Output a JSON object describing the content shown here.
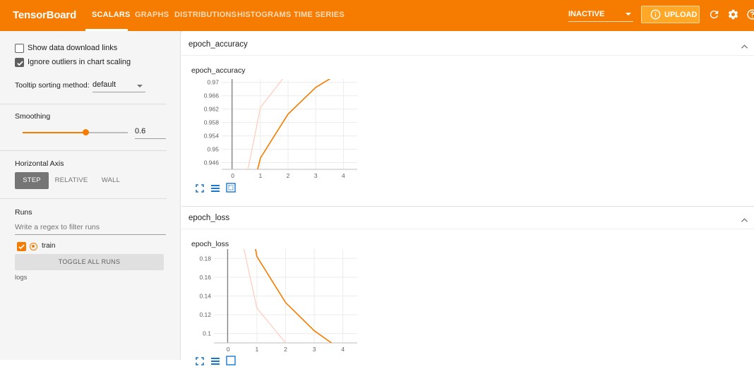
{
  "app": {
    "title": "TensorBoard",
    "accent": "#f57c00"
  },
  "tabs": [
    {
      "label": "SCALARS",
      "active": true
    },
    {
      "label": "GRAPHS"
    },
    {
      "label": "DISTRIBUTIONS"
    },
    {
      "label": "HISTOGRAMS"
    },
    {
      "label": "TIME SERIES"
    }
  ],
  "header": {
    "status_value": "INACTIVE",
    "upload_label": "UPLOAD",
    "icons": [
      "info-icon",
      "refresh-icon",
      "gear-icon",
      "help-icon"
    ]
  },
  "sidebar": {
    "show_download_links": {
      "label": "Show data download links",
      "checked": false
    },
    "ignore_outliers": {
      "label": "Ignore outliers in chart scaling",
      "checked": true
    },
    "tooltip_sort": {
      "label": "Tooltip sorting method:",
      "value": "default"
    },
    "smoothing": {
      "label": "Smoothing",
      "value": "0.6",
      "fraction": 0.6
    },
    "horizontal_axis": {
      "label": "Horizontal Axis",
      "options": [
        "STEP",
        "RELATIVE",
        "WALL"
      ],
      "selected": "STEP"
    },
    "runs": {
      "label": "Runs",
      "filter_placeholder": "Write a regex to filter runs",
      "items": [
        {
          "name": "train",
          "checked": true,
          "color": "#f57c00"
        }
      ],
      "toggle_all_label": "TOGGLE ALL RUNS",
      "logdir": "logs"
    }
  },
  "cards": [
    {
      "header": "epoch_accuracy",
      "chart_title": "epoch_accuracy"
    },
    {
      "header": "epoch_loss",
      "chart_title": "epoch_loss"
    }
  ],
  "chart_data": [
    {
      "type": "line",
      "title": "epoch_accuracy",
      "x_ticks": [
        0,
        1,
        2,
        3,
        4
      ],
      "y_ticks": [
        "0.946",
        "0.95",
        "0.954",
        "0.958",
        "0.962",
        "0.966",
        "0.97"
      ],
      "xlim": [
        -0.4,
        4.5
      ],
      "ylim": [
        0.944,
        0.971
      ],
      "series": [
        {
          "name": "train",
          "smoothed": true,
          "color": "#f57c00",
          "x": [
            0.9,
            1,
            2,
            3,
            3.6
          ],
          "y": [
            0.944,
            0.9474,
            0.9605,
            0.9685,
            0.9715
          ]
        },
        {
          "name": "train",
          "smoothed": false,
          "color": "#ffccbc",
          "x": [
            0.55,
            1,
            1.85
          ],
          "y": [
            0.944,
            0.9625,
            0.9715
          ]
        }
      ]
    },
    {
      "type": "line",
      "title": "epoch_loss",
      "x_ticks": [
        0,
        1,
        2,
        3,
        4
      ],
      "y_ticks": [
        "0.1",
        "0.12",
        "0.14",
        "0.16",
        "0.18"
      ],
      "xlim": [
        -0.5,
        4.5
      ],
      "ylim": [
        0.09,
        0.19
      ],
      "series": [
        {
          "name": "train",
          "smoothed": true,
          "color": "#f57c00",
          "x": [
            0.95,
            1,
            2,
            3,
            3.6
          ],
          "y": [
            0.19,
            0.182,
            0.133,
            0.103,
            0.09
          ]
        },
        {
          "name": "train",
          "smoothed": false,
          "color": "#ffccbc",
          "x": [
            0.55,
            1,
            2
          ],
          "y": [
            0.19,
            0.127,
            0.09
          ]
        }
      ]
    }
  ]
}
